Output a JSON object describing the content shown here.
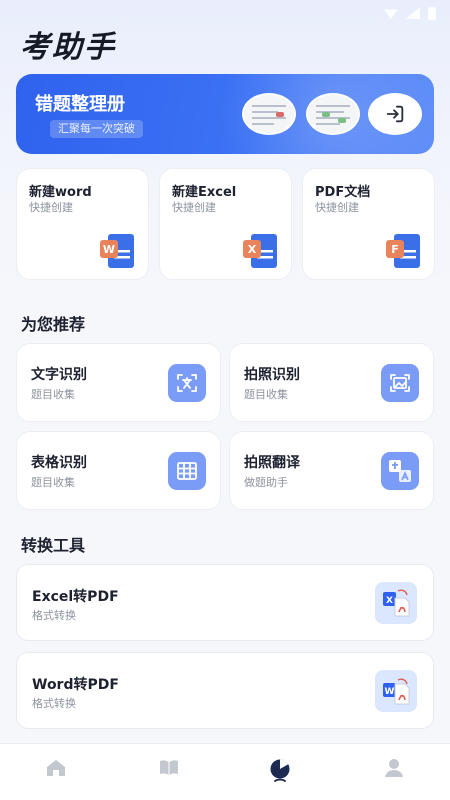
{
  "app": {
    "title": "考助手"
  },
  "hero": {
    "title": "错题整理册",
    "tag": "汇聚每一次突破"
  },
  "create": [
    {
      "title": "新建word",
      "sub": "快捷创建",
      "icon": "word-doc-icon",
      "letter": "W"
    },
    {
      "title": "新建Excel",
      "sub": "快捷创建",
      "icon": "excel-doc-icon",
      "letter": "X"
    },
    {
      "title": "PDF文档",
      "sub": "快捷创建",
      "icon": "pdf-doc-icon",
      "letter": "F"
    }
  ],
  "recommend": {
    "title": "为您推荐",
    "items": [
      {
        "title": "文字识别",
        "sub": "题目收集",
        "icon": "text-recognition-icon"
      },
      {
        "title": "拍照识别",
        "sub": "题目收集",
        "icon": "photo-recognition-icon"
      },
      {
        "title": "表格识别",
        "sub": "题目收集",
        "icon": "table-recognition-icon"
      },
      {
        "title": "拍照翻译",
        "sub": "做题助手",
        "icon": "photo-translate-icon"
      }
    ]
  },
  "tools": {
    "title": "转换工具",
    "items": [
      {
        "title": "Excel转PDF",
        "sub": "格式转换",
        "icon": "excel-to-pdf-icon"
      },
      {
        "title": "Word转PDF",
        "sub": "格式转换",
        "icon": "word-to-pdf-icon"
      }
    ]
  },
  "tabbar": {
    "items": [
      "home-icon",
      "book-icon",
      "chart-icon",
      "profile-icon"
    ],
    "active": 2
  },
  "colors": {
    "accent": "#2f62ee",
    "icon_blue": "#7a9cf6",
    "doc_orange": "#e9835c"
  }
}
